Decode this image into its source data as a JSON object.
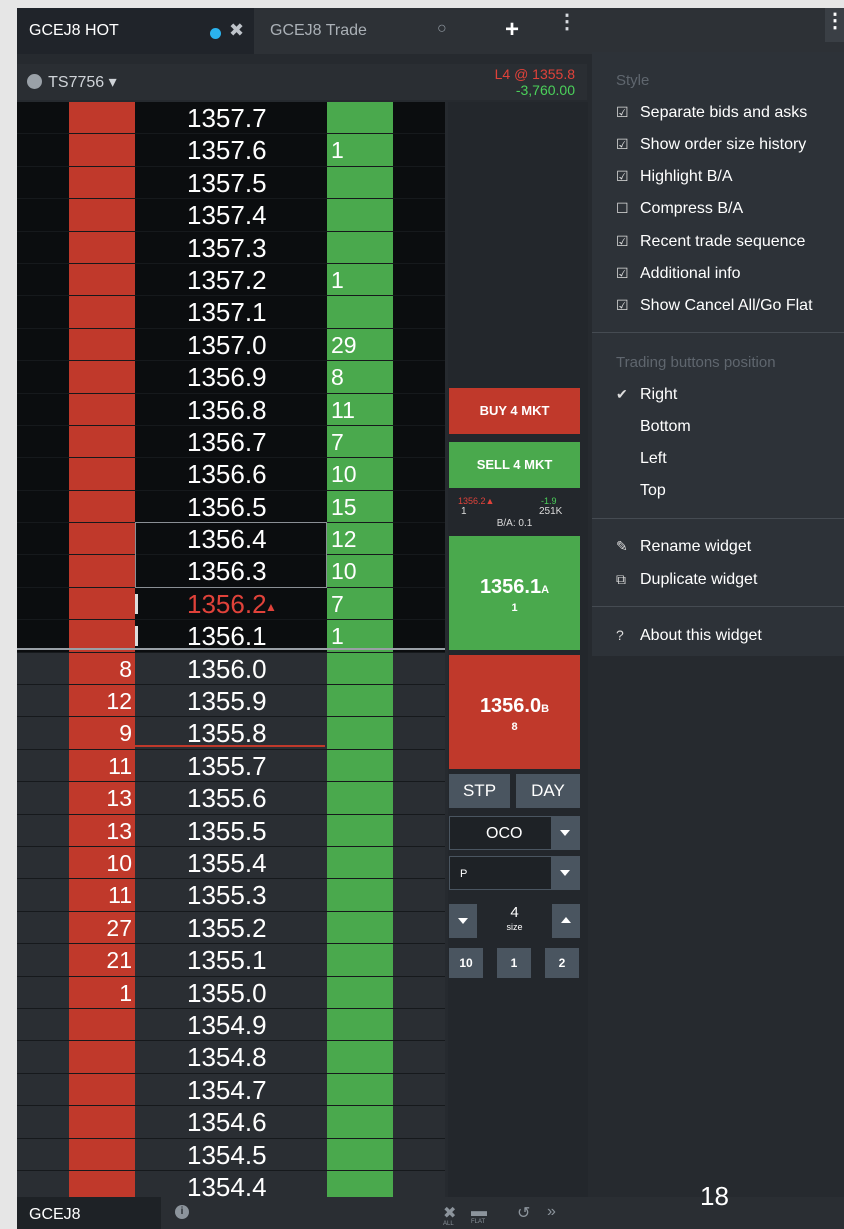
{
  "tabs": [
    {
      "label": "GCEJ8 HOT",
      "close": "✖"
    },
    {
      "label": "GCEJ8 Trade",
      "close": "○"
    }
  ],
  "toolbar": {
    "add": "+",
    "menu": "⋮"
  },
  "account": {
    "id": "TS7756",
    "caret": "▾"
  },
  "last_trade": {
    "line1": "L4 @ 1355.8",
    "line2": "-3,760.00"
  },
  "ladder": {
    "top_rows": [
      {
        "price": "1357.7",
        "bid": "",
        "ask": ""
      },
      {
        "price": "1357.6",
        "bid": "",
        "ask": "1"
      },
      {
        "price": "1357.5",
        "bid": "",
        "ask": ""
      },
      {
        "price": "1357.4",
        "bid": "",
        "ask": ""
      },
      {
        "price": "1357.3",
        "bid": "",
        "ask": ""
      },
      {
        "price": "1357.2",
        "bid": "",
        "ask": "1"
      },
      {
        "price": "1357.1",
        "bid": "",
        "ask": ""
      },
      {
        "price": "1357.0",
        "bid": "",
        "ask": "29"
      },
      {
        "price": "1356.9",
        "bid": "",
        "ask": "8"
      },
      {
        "price": "1356.8",
        "bid": "",
        "ask": "11"
      },
      {
        "price": "1356.7",
        "bid": "",
        "ask": "7"
      },
      {
        "price": "1356.6",
        "bid": "",
        "ask": "10"
      },
      {
        "price": "1356.5",
        "bid": "",
        "ask": "15"
      },
      {
        "price": "1356.4",
        "bid": "",
        "ask": "12"
      },
      {
        "price": "1356.3",
        "bid": "",
        "ask": "10"
      },
      {
        "price": "1356.2",
        "bid": "",
        "ask": "7",
        "last": true
      },
      {
        "price": "1356.1",
        "bid": "",
        "ask": "1"
      }
    ],
    "bottom_rows": [
      {
        "price": "1356.0",
        "bid": "8",
        "ask": ""
      },
      {
        "price": "1355.9",
        "bid": "12",
        "ask": ""
      },
      {
        "price": "1355.8",
        "bid": "9",
        "ask": ""
      },
      {
        "price": "1355.7",
        "bid": "11",
        "ask": ""
      },
      {
        "price": "1355.6",
        "bid": "13",
        "ask": ""
      },
      {
        "price": "1355.5",
        "bid": "13",
        "ask": ""
      },
      {
        "price": "1355.4",
        "bid": "10",
        "ask": ""
      },
      {
        "price": "1355.3",
        "bid": "11",
        "ask": ""
      },
      {
        "price": "1355.2",
        "bid": "27",
        "ask": ""
      },
      {
        "price": "1355.1",
        "bid": "21",
        "ask": ""
      },
      {
        "price": "1355.0",
        "bid": "1",
        "ask": ""
      },
      {
        "price": "1354.9",
        "bid": "",
        "ask": ""
      },
      {
        "price": "1354.8",
        "bid": "",
        "ask": ""
      },
      {
        "price": "1354.7",
        "bid": "",
        "ask": ""
      },
      {
        "price": "1354.6",
        "bid": "",
        "ask": ""
      },
      {
        "price": "1354.5",
        "bid": "",
        "ask": ""
      },
      {
        "price": "1354.4",
        "bid": "",
        "ask": ""
      }
    ],
    "last_marker": "▲"
  },
  "trade_panel": {
    "buy_label": "BUY 4 MKT",
    "sell_label": "SELL 4 MKT",
    "stats": {
      "last_price": "1356.2▲",
      "change": "-1.9",
      "last_size": "1",
      "volume": "251K",
      "bid_ask_spread": "B/A: 0.1"
    },
    "ask": {
      "price": "1356.1",
      "flag": "A",
      "size": "1"
    },
    "bid": {
      "price": "1356.0",
      "flag": "B",
      "size": "8"
    },
    "stp_label": "STP",
    "day_label": "DAY",
    "order_type": "OCO",
    "account_select": "P",
    "size": {
      "value": "4",
      "unit": "size"
    },
    "quick_sizes": [
      "10",
      "1",
      "2"
    ]
  },
  "menu": {
    "style_header": "Style",
    "style_items": [
      {
        "label": "Separate bids and asks",
        "icon": "☑"
      },
      {
        "label": "Show order size history",
        "icon": "☑"
      },
      {
        "label": "Highlight B/A",
        "icon": "☑"
      },
      {
        "label": "Compress B/A",
        "icon": "☐"
      },
      {
        "label": "Recent trade sequence",
        "icon": "☑"
      },
      {
        "label": "Additional info",
        "icon": "☑"
      },
      {
        "label": "Show Cancel All/Go Flat",
        "icon": "☑"
      }
    ],
    "position_header": "Trading buttons position",
    "position_items": [
      {
        "label": "Right",
        "icon": "✔"
      },
      {
        "label": "Bottom",
        "icon": ""
      },
      {
        "label": "Left",
        "icon": ""
      },
      {
        "label": "Top",
        "icon": ""
      }
    ],
    "rename": {
      "label": "Rename widget",
      "icon": "✎"
    },
    "duplicate": {
      "label": "Duplicate widget",
      "icon": "⧉"
    },
    "about": {
      "label": "About this widget",
      "icon": "?"
    }
  },
  "bottom_bar": {
    "symbol": "GCEJ8",
    "info_icon": "i",
    "cancel_all_label": "ALL",
    "flat_label": "FLAT",
    "undo_icon": "↺",
    "more_icon": "»"
  },
  "page_number": "18"
}
